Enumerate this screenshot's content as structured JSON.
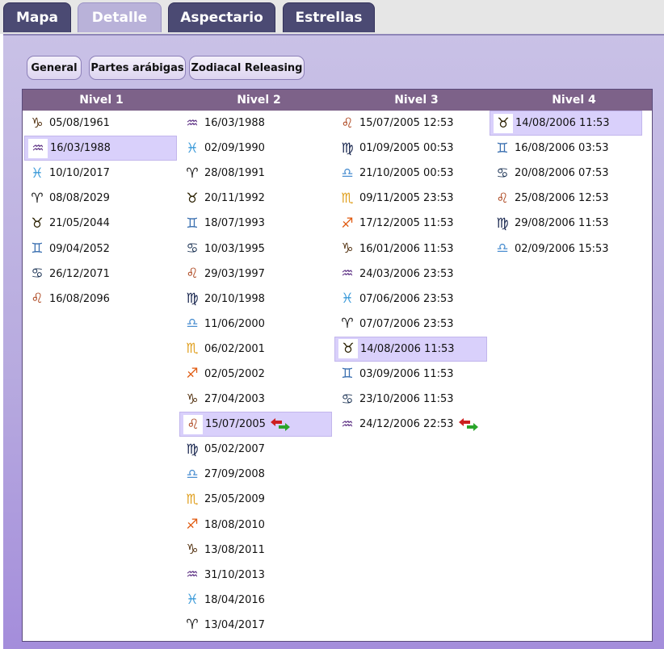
{
  "tabs": [
    {
      "label": "Mapa",
      "active": false
    },
    {
      "label": "Detalle",
      "active": true
    },
    {
      "label": "Aspectario",
      "active": false
    },
    {
      "label": "Estrellas",
      "active": false
    }
  ],
  "subtabs": [
    "General",
    "Partes arábigas",
    "Zodiacal Releasing"
  ],
  "colors": {
    "capricorn": "#5a3a1a",
    "aquarius": "#5a2d82",
    "pisces": "#3a9ad9",
    "aries": "#1a1a1a",
    "taurus": "#2a2000",
    "gemini": "#3a6fb0",
    "cancer": "#1e3556",
    "leo": "#a83a10",
    "virgo": "#12204a",
    "libra": "#4a8ed0",
    "scorpio": "#e0a020",
    "sagittarius": "#e05a10"
  },
  "symbols": {
    "capricorn": "♑",
    "aquarius": "♒",
    "pisces": "♓",
    "aries": "♈",
    "taurus": "♉",
    "gemini": "♊",
    "cancer": "♋",
    "leo": "♌",
    "virgo": "♍",
    "libra": "♎",
    "scorpio": "♏",
    "sagittarius": "♐"
  },
  "levels": [
    {
      "title": "Nivel 1",
      "rows": [
        {
          "sign": "capricorn",
          "date": "05/08/1961"
        },
        {
          "sign": "aquarius",
          "date": "16/03/1988",
          "selected": true
        },
        {
          "sign": "pisces",
          "date": "10/10/2017"
        },
        {
          "sign": "aries",
          "date": "08/08/2029"
        },
        {
          "sign": "taurus",
          "date": "21/05/2044"
        },
        {
          "sign": "gemini",
          "date": "09/04/2052"
        },
        {
          "sign": "cancer",
          "date": "26/12/2071"
        },
        {
          "sign": "leo",
          "date": "16/08/2096"
        }
      ]
    },
    {
      "title": "Nivel 2",
      "rows": [
        {
          "sign": "aquarius",
          "date": "16/03/1988"
        },
        {
          "sign": "pisces",
          "date": "02/09/1990"
        },
        {
          "sign": "aries",
          "date": "28/08/1991"
        },
        {
          "sign": "taurus",
          "date": "20/11/1992"
        },
        {
          "sign": "gemini",
          "date": "18/07/1993"
        },
        {
          "sign": "cancer",
          "date": "10/03/1995"
        },
        {
          "sign": "leo",
          "date": "29/03/1997"
        },
        {
          "sign": "virgo",
          "date": "20/10/1998"
        },
        {
          "sign": "libra",
          "date": "11/06/2000"
        },
        {
          "sign": "scorpio",
          "date": "06/02/2001"
        },
        {
          "sign": "sagittarius",
          "date": "02/05/2002"
        },
        {
          "sign": "capricorn",
          "date": "27/04/2003"
        },
        {
          "sign": "leo",
          "date": "15/07/2005",
          "selected": true,
          "arrows": true
        },
        {
          "sign": "virgo",
          "date": "05/02/2007"
        },
        {
          "sign": "libra",
          "date": "27/09/2008"
        },
        {
          "sign": "scorpio",
          "date": "25/05/2009"
        },
        {
          "sign": "sagittarius",
          "date": "18/08/2010"
        },
        {
          "sign": "capricorn",
          "date": "13/08/2011"
        },
        {
          "sign": "aquarius",
          "date": "31/10/2013"
        },
        {
          "sign": "pisces",
          "date": "18/04/2016"
        },
        {
          "sign": "aries",
          "date": "13/04/2017"
        }
      ]
    },
    {
      "title": "Nivel 3",
      "rows": [
        {
          "sign": "leo",
          "date": "15/07/2005 12:53"
        },
        {
          "sign": "virgo",
          "date": "01/09/2005 00:53"
        },
        {
          "sign": "libra",
          "date": "21/10/2005 00:53"
        },
        {
          "sign": "scorpio",
          "date": "09/11/2005 23:53"
        },
        {
          "sign": "sagittarius",
          "date": "17/12/2005 11:53"
        },
        {
          "sign": "capricorn",
          "date": "16/01/2006 11:53"
        },
        {
          "sign": "aquarius",
          "date": "24/03/2006 23:53"
        },
        {
          "sign": "pisces",
          "date": "07/06/2006 23:53"
        },
        {
          "sign": "aries",
          "date": "07/07/2006 23:53"
        },
        {
          "sign": "taurus",
          "date": "14/08/2006 11:53",
          "selected": true
        },
        {
          "sign": "gemini",
          "date": "03/09/2006 11:53"
        },
        {
          "sign": "cancer",
          "date": "23/10/2006 11:53"
        },
        {
          "sign": "aquarius",
          "date": "24/12/2006 22:53",
          "arrows": true
        }
      ]
    },
    {
      "title": "Nivel 4",
      "rows": [
        {
          "sign": "taurus",
          "date": "14/08/2006 11:53",
          "selected": true
        },
        {
          "sign": "gemini",
          "date": "16/08/2006 03:53"
        },
        {
          "sign": "cancer",
          "date": "20/08/2006 07:53"
        },
        {
          "sign": "leo",
          "date": "25/08/2006 12:53"
        },
        {
          "sign": "virgo",
          "date": "29/08/2006 11:53"
        },
        {
          "sign": "libra",
          "date": "02/09/2006 15:53"
        }
      ]
    }
  ]
}
